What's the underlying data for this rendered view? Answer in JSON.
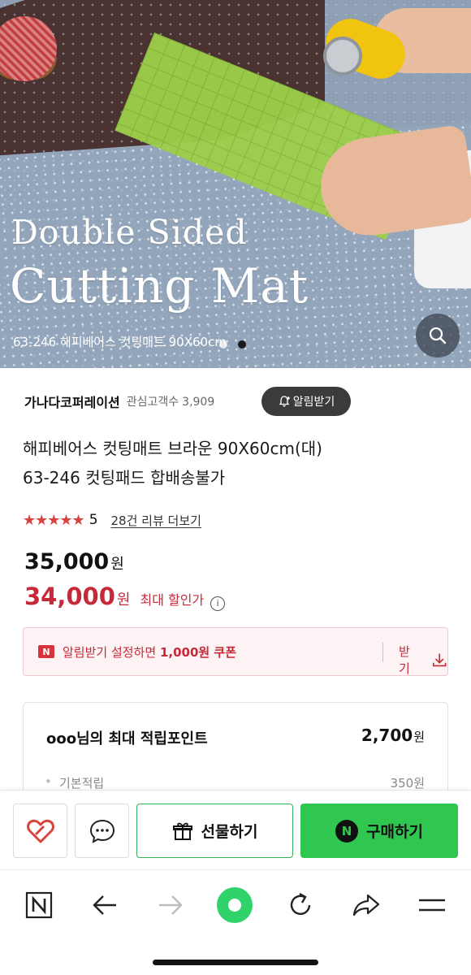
{
  "hero": {
    "title_line1": "Double Sided",
    "title_line2": "Cutting Mat",
    "caption": "63-246 해피베어스 컷팅매트 90X60cm",
    "carousel_total": 2,
    "carousel_active_index": 2
  },
  "seller": {
    "name": "가나다코퍼레이션",
    "followers_label": "관심고객수",
    "followers_count": "3,909",
    "notify_label": "알림받기"
  },
  "product": {
    "title_line1": "해피베어스 컷팅매트 브라운 90X60cm(대)",
    "title_line2": "63-246 컷팅패드 합배송불가"
  },
  "rating": {
    "stars": "★★★★★",
    "score": "5",
    "review_link": "28건 리뷰 더보기"
  },
  "price": {
    "original": "35,000",
    "original_unit": "원",
    "sale": "34,000",
    "sale_unit": "원",
    "sale_tag": "최대 할인가",
    "info_icon": "i"
  },
  "coupon": {
    "badge": "N",
    "text_prefix": "알림받기 설정하면 ",
    "text_highlight": "1,000원 쿠폰",
    "get_label": "받기"
  },
  "points": {
    "title": "ooo님의 최대 적립포인트",
    "total": "2,700",
    "total_unit": "원",
    "sub_label": "기본적립",
    "sub_value": "350원"
  },
  "actions": {
    "gift_label": "선물하기",
    "buy_label": "구매하기",
    "buy_badge": "N"
  },
  "colors": {
    "sale_red": "#c62a38",
    "buy_green": "#2fc74f",
    "gift_border": "#34b35a",
    "star_red": "#d9433b"
  },
  "icons": {
    "search": "search-icon",
    "bell": "bell-icon",
    "download": "download-icon",
    "heart": "heart-icon",
    "chat": "chat-bubble-icon",
    "gift": "gift-icon",
    "home": "naver-home-icon",
    "back": "arrow-left-icon",
    "forward": "arrow-right-icon",
    "green": "green-dot-icon",
    "reload": "reload-icon",
    "share": "share-icon",
    "menu": "menu-icon"
  }
}
